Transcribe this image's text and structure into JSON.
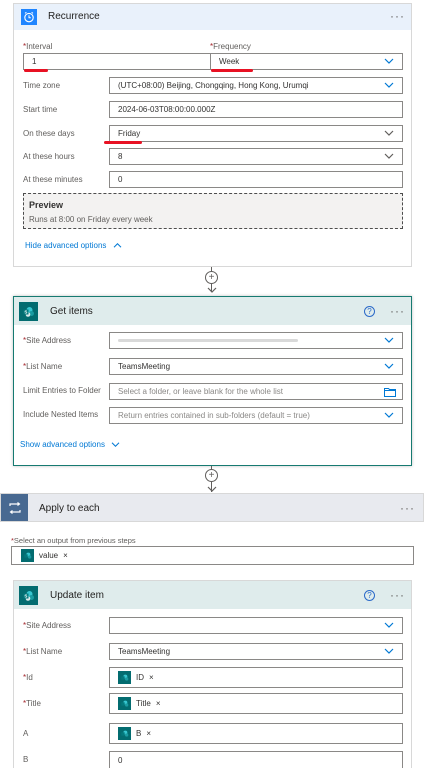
{
  "recurrence": {
    "title": "Recurrence",
    "menu": "···",
    "interval": {
      "label": "Interval",
      "value": "1"
    },
    "frequency": {
      "label": "Frequency",
      "value": "Week"
    },
    "time_zone": {
      "label": "Time zone",
      "value": "(UTC+08:00) Beijing, Chongqing, Hong Kong, Urumqi"
    },
    "start_time": {
      "label": "Start time",
      "value": "2024-06-03T08:00:00.000Z"
    },
    "on_these_days": {
      "label": "On these days",
      "value": "Friday"
    },
    "at_these_hours": {
      "label": "At these hours",
      "value": "8"
    },
    "at_these_minutes": {
      "label": "At these minutes",
      "value": "0"
    },
    "preview": {
      "title": "Preview",
      "text": "Runs at 8:00 on Friday every week"
    },
    "hide_advanced": "Hide advanced options"
  },
  "get_items": {
    "title": "Get items",
    "menu": "···",
    "help": "?",
    "site_address": {
      "label": "Site Address",
      "value": ""
    },
    "list_name": {
      "label": "List Name",
      "value": "TeamsMeeting"
    },
    "limit_entries": {
      "label": "Limit Entries to Folder",
      "placeholder": "Select a folder, or leave blank for the whole list"
    },
    "include_nested": {
      "label": "Include Nested Items",
      "placeholder": "Return entries contained in sub-folders (default = true)"
    },
    "show_advanced": "Show advanced options"
  },
  "apply_to_each": {
    "title": "Apply to each",
    "menu": "···",
    "select_label": "Select an output from previous steps",
    "token": "value"
  },
  "update_item": {
    "title": "Update item",
    "menu": "···",
    "help": "?",
    "site_address": {
      "label": "Site Address",
      "value": ""
    },
    "list_name": {
      "label": "List Name",
      "value": "TeamsMeeting"
    },
    "id": {
      "label": "Id",
      "token": "ID"
    },
    "title_field": {
      "label": "Title",
      "token": "Title"
    },
    "a": {
      "label": "A",
      "token": "B"
    },
    "b": {
      "label": "B",
      "value": "0"
    }
  },
  "connector": {
    "plus": "+"
  },
  "token_close": "×",
  "colors": {
    "recurrence_header": "#e9f1fb",
    "recurrence_icon": "#1f85ff",
    "sharepoint_header": "#dfecec",
    "sharepoint_icon": "#036c70",
    "apply_header": "#e8eaef",
    "apply_icon": "#486991",
    "link": "#0078d4",
    "annotation": "#e81123"
  },
  "icons": {
    "recurrence": "alarm-clock-icon",
    "sharepoint": "sharepoint-icon",
    "apply": "loop-icon",
    "folder": "folder-icon",
    "chevron": "chevron-down-icon",
    "chevron_up": "chevron-up-icon"
  }
}
